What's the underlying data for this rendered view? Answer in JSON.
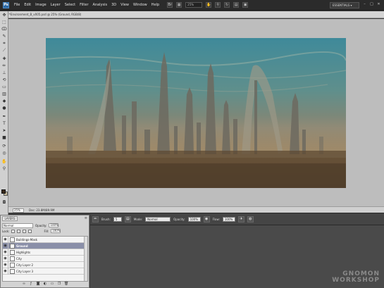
{
  "app": {
    "logo": "Ps",
    "menu": [
      "File",
      "Edit",
      "Image",
      "Layer",
      "Select",
      "Filter",
      "Analysis",
      "3D",
      "View",
      "Window",
      "Help"
    ],
    "toolbar_icons": [
      "bridge-icon",
      "mini-bridge-icon",
      "zoom-icon",
      "hand-icon",
      "rotate-icon",
      "arrange-icon",
      "screen-mode-icon"
    ],
    "zoom_level": "25%",
    "workspace": "ESSENTIALS ▾",
    "window_controls": [
      "–",
      "□",
      "✕"
    ]
  },
  "document": {
    "tab_title": "Environment_B_v005.psd @ 25% (Ground, RGB/8)",
    "close_glyph": "×"
  },
  "status": {
    "zoom": "25%",
    "info": "Doc: 23.8M/89.9M"
  },
  "options": {
    "brush_label": "Brush:",
    "brush_size": "5",
    "mode_label": "Mode:",
    "mode_value": "Normal",
    "opacity_label": "Opacity:",
    "opacity_value": "100%",
    "flow_label": "Flow:",
    "flow_value": "100%"
  },
  "layers": {
    "tab_label": "LAYERS",
    "blend_mode": "Normal",
    "opacity_label": "Opacity:",
    "opacity_value": "100%",
    "lock_label": "Lock:",
    "fill_label": "Fill:",
    "fill_value": "100%",
    "rows": [
      {
        "name": "Buildings-Mask",
        "selected": false,
        "folder": false
      },
      {
        "name": "Ground",
        "selected": true,
        "folder": false
      },
      {
        "name": "Highlights",
        "selected": false,
        "folder": false
      },
      {
        "name": "City",
        "selected": false,
        "folder": false
      },
      {
        "name": "City Layer 2",
        "selected": false,
        "folder": false
      },
      {
        "name": "City Layer 3",
        "selected": false,
        "folder": false
      }
    ]
  },
  "watermark": {
    "line1": "GNOMON",
    "line2": "WORKSHOP"
  },
  "colors": {
    "accent": "#2d6aa6",
    "foreground": "#3a2a1a",
    "background": "#c4b89a"
  }
}
